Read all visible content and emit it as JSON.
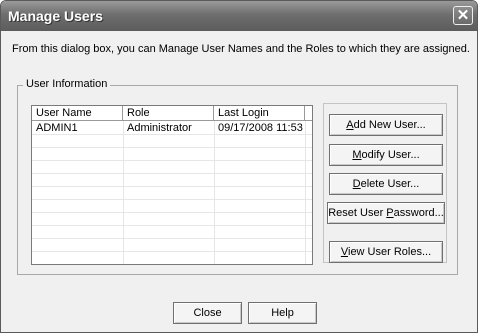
{
  "window": {
    "title": "Manage Users",
    "close_glyph": "✕",
    "description": "From this dialog box, you can Manage User Names and the Roles to which they are assigned."
  },
  "group": {
    "label": "User Information"
  },
  "table": {
    "columns": [
      "User Name",
      "Role",
      "Last Login"
    ],
    "rows": [
      [
        "ADMIN1",
        "Administrator",
        "09/17/2008 11:53"
      ]
    ]
  },
  "buttons": {
    "add_new_user": {
      "before": "",
      "key": "A",
      "after": "dd New User..."
    },
    "modify_user": {
      "before": "",
      "key": "M",
      "after": "odify User..."
    },
    "delete_user": {
      "before": "",
      "key": "D",
      "after": "elete User..."
    },
    "reset_password": {
      "before": "Reset User ",
      "key": "P",
      "after": "assword..."
    },
    "view_user_roles": {
      "before": "",
      "key": "V",
      "after": "iew User Roles..."
    },
    "close": "Close",
    "help": "Help"
  }
}
